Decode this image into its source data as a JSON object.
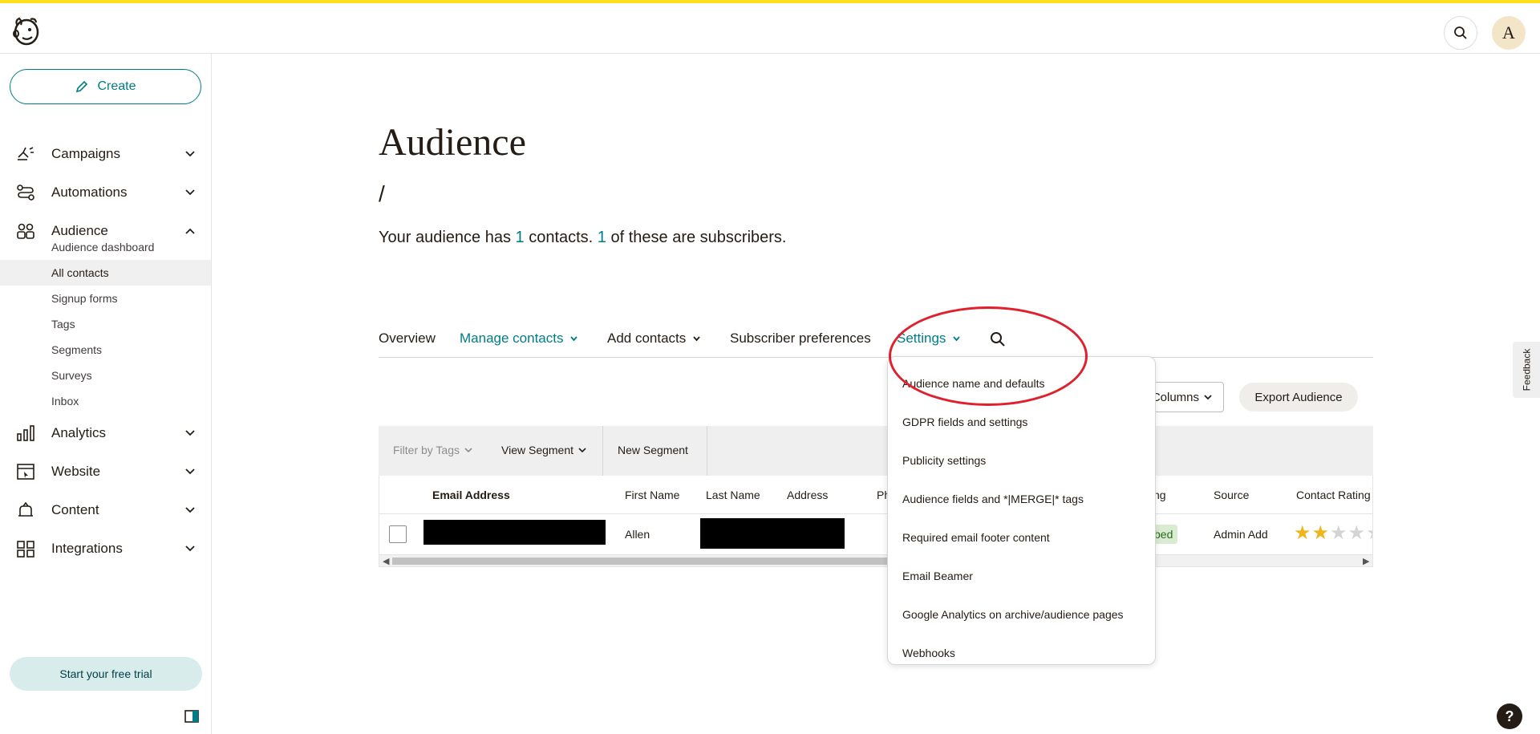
{
  "header": {
    "logo_icon": "mailchimp-freddie-icon",
    "search_icon": "search-icon",
    "avatar_initial": "A"
  },
  "sidebar": {
    "create_label": "Create",
    "nav": [
      {
        "label": "Campaigns",
        "icon": "megaphone-icon"
      },
      {
        "label": "Automations",
        "icon": "automation-icon"
      },
      {
        "label": "Audience",
        "icon": "audience-icon"
      },
      {
        "label": "Analytics",
        "icon": "bar-chart-icon"
      },
      {
        "label": "Website",
        "icon": "website-icon"
      },
      {
        "label": "Content",
        "icon": "content-icon"
      },
      {
        "label": "Integrations",
        "icon": "grid-icon"
      }
    ],
    "audience_sub": [
      "Audience dashboard",
      "All contacts",
      "Signup forms",
      "Tags",
      "Segments",
      "Surveys",
      "Inbox"
    ],
    "active_sub": "All contacts",
    "trial_label": "Start your free trial"
  },
  "main": {
    "title": "Audience",
    "breadcrumb": "/",
    "summary": {
      "prefix": "Your audience has ",
      "contacts": "1",
      "mid": " contacts. ",
      "subscribers": "1",
      "suffix": " of these are subscribers."
    },
    "tabs": [
      "Overview",
      "Manage contacts",
      "Add contacts",
      "Subscriber preferences",
      "Settings"
    ],
    "columns_label": "Columns",
    "export_label": "Export Audience",
    "filter_bar": {
      "filter_tags": "Filter by Tags",
      "view_segment": "View Segment",
      "new_segment": "New Segment"
    },
    "table": {
      "headers": [
        "Email Address",
        "First Name",
        "Last Name",
        "Address",
        "Ph",
        "ting",
        "Source",
        "Contact Rating"
      ],
      "row": {
        "first_name": "Allen",
        "status": "bed",
        "source": "Admin Add",
        "rating": 2,
        "rating_max": 5
      }
    }
  },
  "settings_dropdown": {
    "items": [
      "Audience name and defaults",
      "GDPR fields and settings",
      "Publicity settings",
      "Audience fields and *|MERGE|* tags",
      "Required email footer content",
      "Email Beamer",
      "Google Analytics on archive/audience pages",
      "Webhooks"
    ]
  },
  "feedback_label": "Feedback",
  "help_label": "?",
  "colors": {
    "accent": "#007c89",
    "brand_yellow": "#ffe01b",
    "annotation_red": "#e0202c"
  }
}
